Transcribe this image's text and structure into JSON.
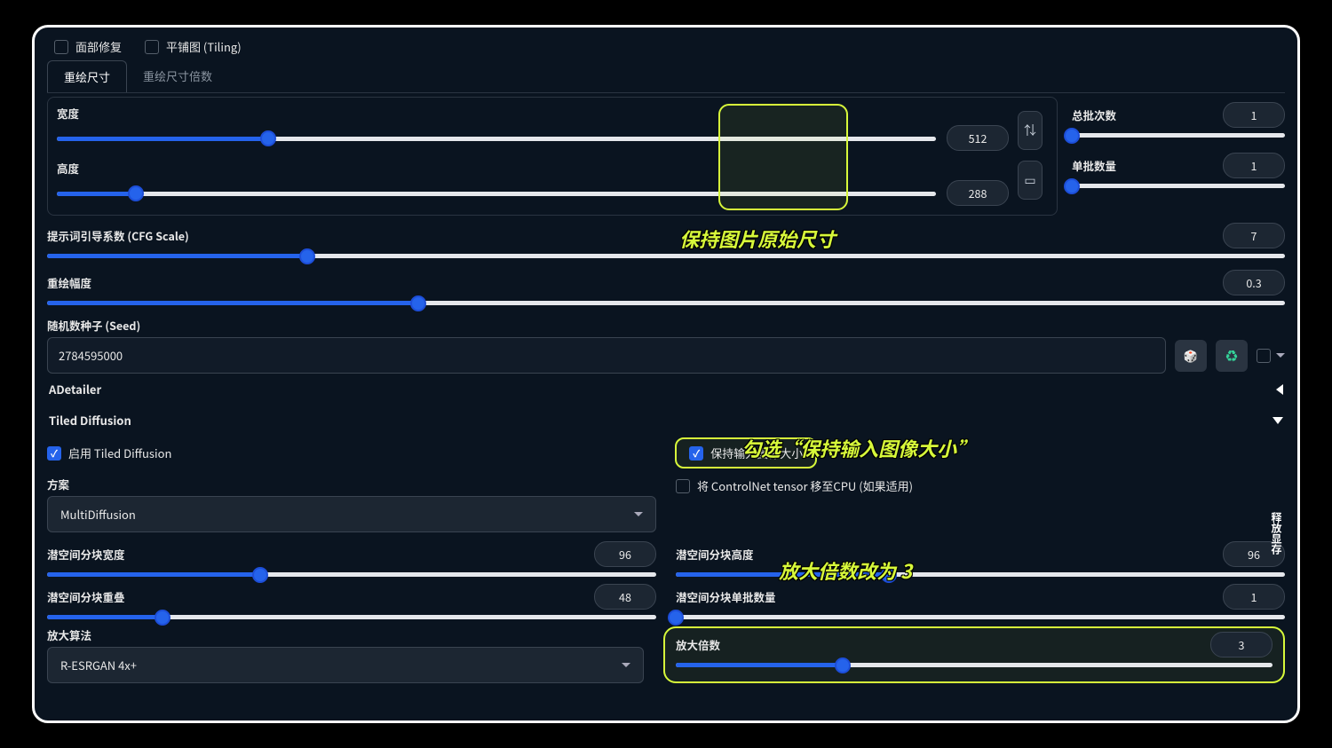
{
  "top_checks": {
    "face_fix": "面部修复",
    "tiling": "平铺图 (Tiling)"
  },
  "tabs": {
    "resize": "重绘尺寸",
    "resize_by": "重绘尺寸倍数"
  },
  "dims": {
    "width_label": "宽度",
    "width_val": "512",
    "height_label": "高度",
    "height_val": "288"
  },
  "right": {
    "batch_count_label": "总批次数",
    "batch_count_val": "1",
    "batch_size_label": "单批数量",
    "batch_size_val": "1"
  },
  "cfg": {
    "label": "提示词引导系数 (CFG Scale)",
    "val": "7"
  },
  "denoise": {
    "label": "重绘幅度",
    "val": "0.3"
  },
  "seed": {
    "label": "随机数种子 (Seed)",
    "val": "2784595000"
  },
  "acc": {
    "adetailer": "ADetailer",
    "tiled": "Tiled Diffusion"
  },
  "tiled": {
    "enable": "启用 Tiled Diffusion",
    "keep_input": "保持输入图像大小",
    "method_label": "方案",
    "method_val": "MultiDiffusion",
    "move_cpu": "将 ControlNet tensor 移至CPU (如果适用)",
    "tile_w_label": "潜空间分块宽度",
    "tile_w_val": "96",
    "tile_h_label": "潜空间分块高度",
    "tile_h_val": "96",
    "overlap_label": "潜空间分块重叠",
    "overlap_val": "48",
    "tile_bs_label": "潜空间分块单批数量",
    "tile_bs_val": "1",
    "upscaler_label": "放大算法",
    "upscaler_val": "R-ESRGAN 4x+",
    "scale_label": "放大倍数",
    "scale_val": "3"
  },
  "vtext": "释放显存",
  "annotations": {
    "keep_original": "保持图片原始尺寸",
    "check_keep_input": "勾选“保持输入图像大小”",
    "scale_to_3": "放大倍数改为 3"
  },
  "icons": {
    "dice": "🎲",
    "recycle": "♻",
    "swap1": "⇅",
    "swap2": "▭"
  }
}
